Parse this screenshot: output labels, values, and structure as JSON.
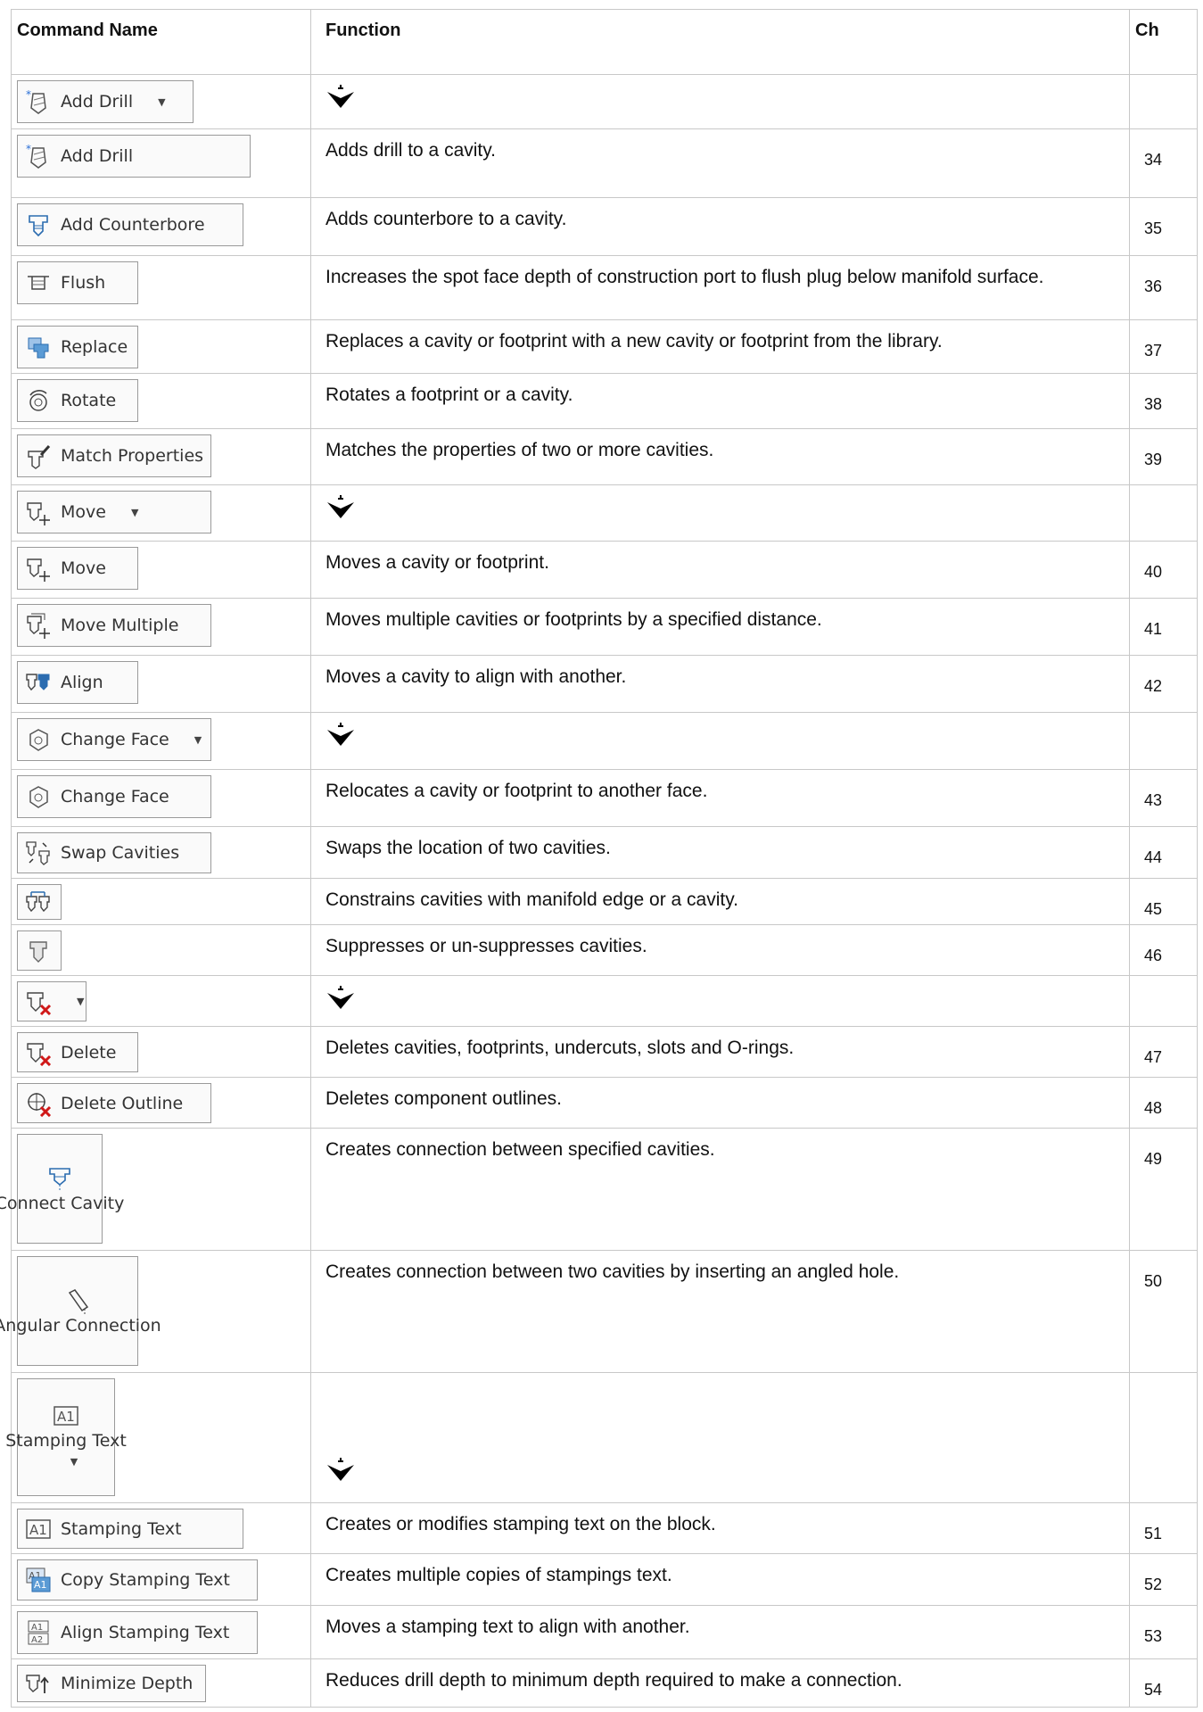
{
  "headers": {
    "command": "Command Name",
    "function": "Function",
    "ch": "Ch"
  },
  "rows": [
    {
      "label": "Add Drill",
      "icon": "drill-icon",
      "dropdown": true,
      "function": "",
      "ch": "",
      "h": 61,
      "bw": 198
    },
    {
      "label": "Add Drill",
      "icon": "drill-icon",
      "function": "Adds drill to a cavity.",
      "ch": "34",
      "h": 77,
      "bw": 262
    },
    {
      "label": "Add Counterbore",
      "icon": "counterbore-icon",
      "function": "Adds counterbore to a cavity.",
      "ch": "35",
      "h": 65,
      "bw": 254
    },
    {
      "label": "Flush",
      "icon": "flush-icon",
      "function": "Increases the spot face depth of construction port to flush plug below manifold surface.",
      "ch": "36",
      "h": 72,
      "bw": 136
    },
    {
      "label": "Replace",
      "icon": "replace-icon",
      "function": "Replaces a cavity or footprint with a new cavity or footprint from the library.",
      "ch": "37",
      "h": 60,
      "bw": 136
    },
    {
      "label": "Rotate",
      "icon": "rotate-icon",
      "function": "Rotates a footprint or a cavity.",
      "ch": "38",
      "h": 62,
      "bw": 136
    },
    {
      "label": "Match Properties",
      "icon": "match-properties-icon",
      "function": "Matches the properties of two or more cavities.",
      "ch": "39",
      "h": 63,
      "bw": 218
    },
    {
      "label": "Move",
      "icon": "move-icon",
      "dropdown": true,
      "function": "",
      "ch": "",
      "h": 63,
      "bw": 218
    },
    {
      "label": "Move",
      "icon": "move-icon",
      "function": "Moves a cavity or footprint.",
      "ch": "40",
      "h": 64,
      "bw": 136
    },
    {
      "label": "Move Multiple",
      "icon": "move-multiple-icon",
      "function": "Moves multiple cavities or footprints by a specified distance.",
      "ch": "41",
      "h": 64,
      "bw": 218
    },
    {
      "label": "Align",
      "icon": "align-icon",
      "function": "Moves a cavity to align with another.",
      "ch": "42",
      "h": 64,
      "bw": 136
    },
    {
      "label": "Change Face",
      "icon": "change-face-icon",
      "dropdown": true,
      "function": "",
      "ch": "",
      "h": 64,
      "bw": 218
    },
    {
      "label": "Change Face",
      "icon": "change-face-icon",
      "function": "Relocates a cavity or footprint to another face.",
      "ch": "43",
      "h": 64,
      "bw": 218
    },
    {
      "label": "Swap Cavities",
      "icon": "swap-cavities-icon",
      "function": "Swaps the location of two cavities.",
      "ch": "44",
      "h": 58,
      "bw": 218
    },
    {
      "label": "",
      "icon": "constrain-icon",
      "function": "Constrains cavities with manifold edge or a cavity.",
      "ch": "45",
      "h": 52,
      "bw": 50
    },
    {
      "label": "",
      "icon": "suppress-icon",
      "function": "Suppresses or un-suppresses cavities.",
      "ch": "46",
      "h": 57,
      "bw": 50
    },
    {
      "label": "",
      "icon": "delete-icon",
      "dropdown": true,
      "function": "",
      "ch": "",
      "h": 57,
      "bw": 78
    },
    {
      "label": "Delete",
      "icon": "delete-icon",
      "function": "Deletes cavities, footprints, undercuts, slots and O-rings.",
      "ch": "47",
      "h": 57,
      "bw": 136
    },
    {
      "label": "Delete Outline",
      "icon": "delete-outline-icon",
      "function": "Deletes component outlines.",
      "ch": "48",
      "h": 57,
      "bw": 218
    },
    {
      "label": "Connect Cavity",
      "icon": "connect-cavity-icon",
      "tall": true,
      "function": "Creates connection between specified cavities.",
      "ch": "49",
      "h": 137,
      "bw": 96
    },
    {
      "label": "Angular Connection",
      "icon": "angular-connection-icon",
      "tall": true,
      "function": "Creates connection between two cavities by inserting an angled hole.",
      "ch": "50",
      "h": 137,
      "bw": 136
    },
    {
      "label": "Stamping Text",
      "icon": "stamping-text-icon",
      "tall": true,
      "dropdown": true,
      "function": "",
      "ch": "",
      "h": 146,
      "bw": 110
    },
    {
      "label": "Stamping Text",
      "icon": "stamping-text-icon",
      "function": "Creates or modifies stamping text on the block.",
      "ch": "51",
      "h": 57,
      "bw": 254
    },
    {
      "label": "Copy Stamping Text",
      "icon": "copy-stamping-text-icon",
      "function": "Creates multiple copies of stampings text.",
      "ch": "52",
      "h": 58,
      "bw": 270
    },
    {
      "label": "Align Stamping Text",
      "icon": "align-stamping-text-icon",
      "function": "Moves a stamping text to align with another.",
      "ch": "53",
      "h": 60,
      "bw": 270
    },
    {
      "label": "Minimize Depth",
      "icon": "minimize-depth-icon",
      "function": "Reduces drill depth to minimum depth required to make a connection.",
      "ch": "54",
      "h": 54,
      "bw": 212
    }
  ]
}
